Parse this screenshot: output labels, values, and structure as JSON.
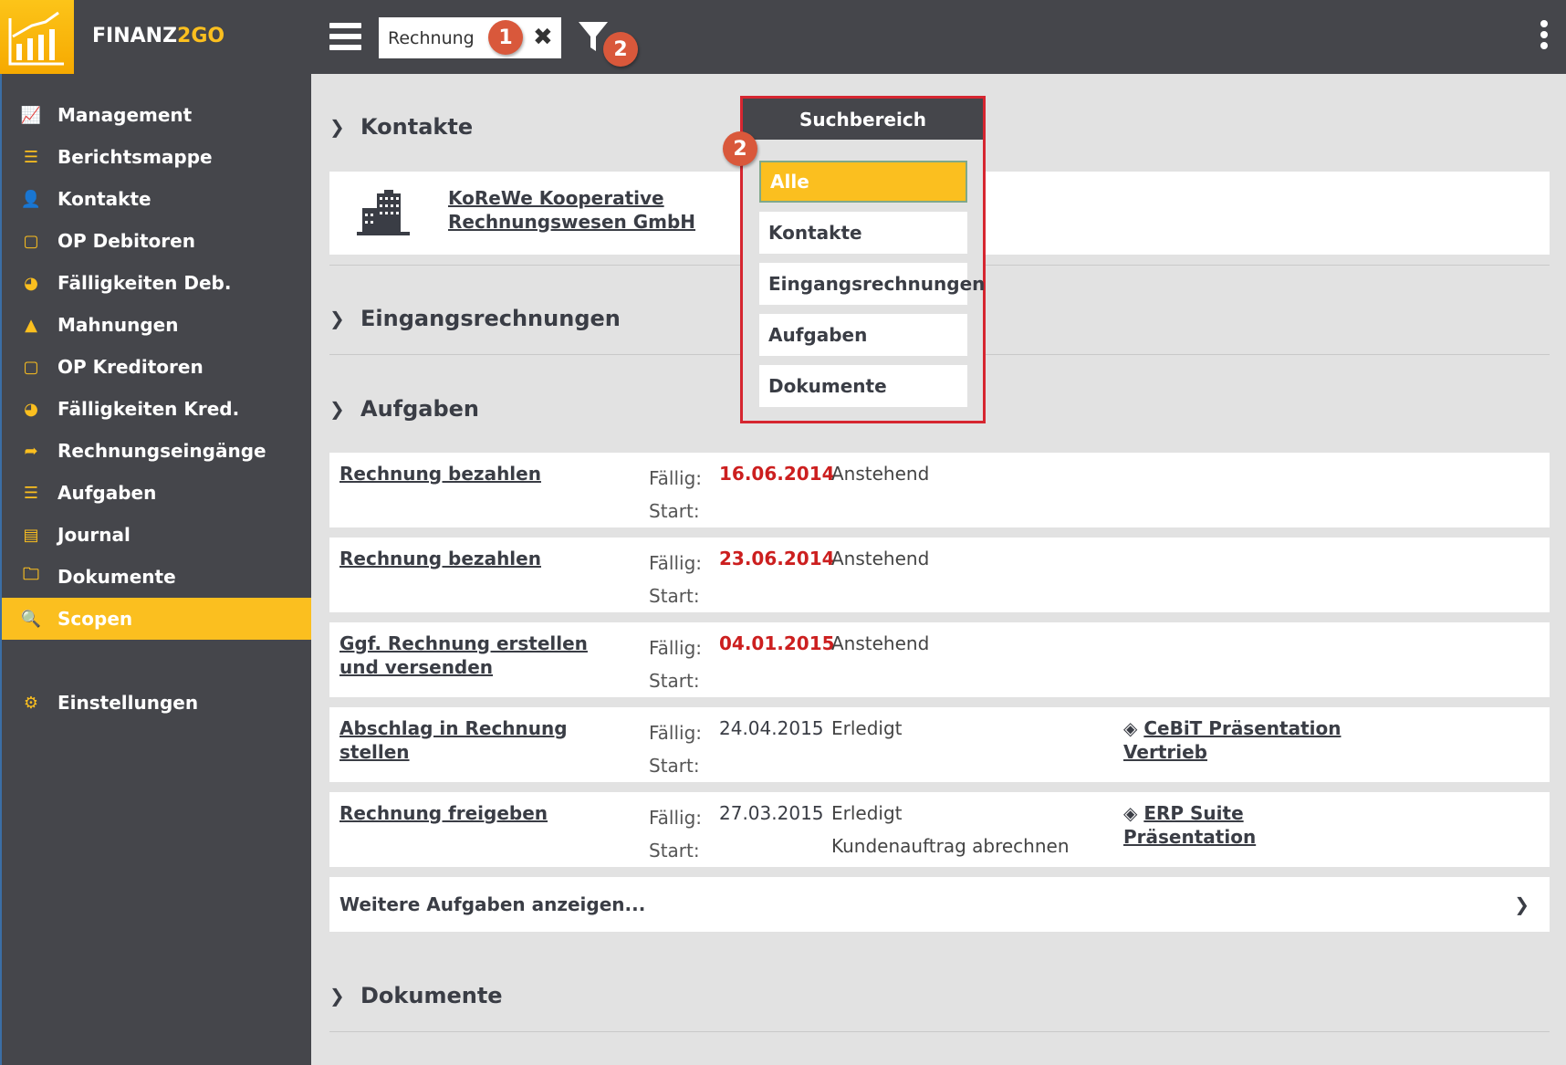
{
  "header": {
    "brand_a": "FINANZ",
    "brand_b": "2GO",
    "search_value": "Rechnung",
    "badge1": "1",
    "badge2": "2"
  },
  "sidebar": {
    "items": [
      {
        "label": "Management",
        "icon": "chart-line-icon",
        "glyph": "📈"
      },
      {
        "label": "Berichtsmappe",
        "icon": "list-icon",
        "glyph": "☰"
      },
      {
        "label": "Kontakte",
        "icon": "user-icon",
        "glyph": "👤"
      },
      {
        "label": "OP Debitoren",
        "icon": "square-icon",
        "glyph": "▢"
      },
      {
        "label": "Fälligkeiten Deb.",
        "icon": "dashboard-icon",
        "glyph": "◕"
      },
      {
        "label": "Mahnungen",
        "icon": "warning-icon",
        "glyph": "▲"
      },
      {
        "label": "OP Kreditoren",
        "icon": "square-icon",
        "glyph": "▢"
      },
      {
        "label": "Fälligkeiten Kred.",
        "icon": "dashboard-icon",
        "glyph": "◕"
      },
      {
        "label": "Rechnungseingänge",
        "icon": "share-icon",
        "glyph": "➦"
      },
      {
        "label": "Aufgaben",
        "icon": "tasks-icon",
        "glyph": "☰"
      },
      {
        "label": "Journal",
        "icon": "journal-icon",
        "glyph": "▤"
      },
      {
        "label": "Dokumente",
        "icon": "folder-icon",
        "glyph": "🗀"
      },
      {
        "label": "Scopen",
        "icon": "search-icon",
        "glyph": "🔍"
      }
    ],
    "settings": {
      "label": "Einstellungen",
      "icon": "gear-icon",
      "glyph": "⚙"
    },
    "active": "Scopen"
  },
  "main": {
    "kontakte": {
      "title": "Kontakte",
      "name1": "KoReWe Kooperative",
      "name2": "Rechnungswesen GmbH"
    },
    "eingang": {
      "title": "Eingangsrechnungen"
    },
    "aufgaben": {
      "title": "Aufgaben",
      "faellig_label": "Fällig:",
      "start_label": "Start:",
      "tasks": [
        {
          "title": "Rechnung bezahlen",
          "due": "16.06.2014",
          "overdue": true,
          "status": "Anstehend",
          "extra": "",
          "link": ""
        },
        {
          "title": "Rechnung bezahlen",
          "due": "23.06.2014",
          "overdue": true,
          "status": "Anstehend",
          "extra": "",
          "link": ""
        },
        {
          "title": "Ggf. Rechnung erstellen und versenden",
          "due": "04.01.2015",
          "overdue": true,
          "status": "Anstehend",
          "extra": "",
          "link": ""
        },
        {
          "title": "Abschlag in Rechnung stellen",
          "due": "24.04.2015",
          "overdue": false,
          "status": "Erledigt",
          "extra": "",
          "link": "CeBiT Präsentation Vertrieb"
        },
        {
          "title": "Rechnung freigeben",
          "due": "27.03.2015",
          "overdue": false,
          "status": "Erledigt",
          "extra": "Kundenauftrag abrechnen",
          "link": "ERP Suite Präsentation"
        }
      ],
      "more": "Weitere Aufgaben anzeigen..."
    },
    "dokumente": {
      "title": "Dokumente"
    }
  },
  "dropdown": {
    "title": "Suchbereich",
    "badge": "2",
    "options": [
      "Alle",
      "Kontakte",
      "Eingangsrechnungen",
      "Aufgaben",
      "Dokumente"
    ],
    "selected": "Alle"
  },
  "colors": {
    "accent": "#fbbf1f",
    "dark": "#45464b",
    "overdue": "#cc1f1f",
    "badge": "#d9583b",
    "highlight_border": "#d62630"
  }
}
